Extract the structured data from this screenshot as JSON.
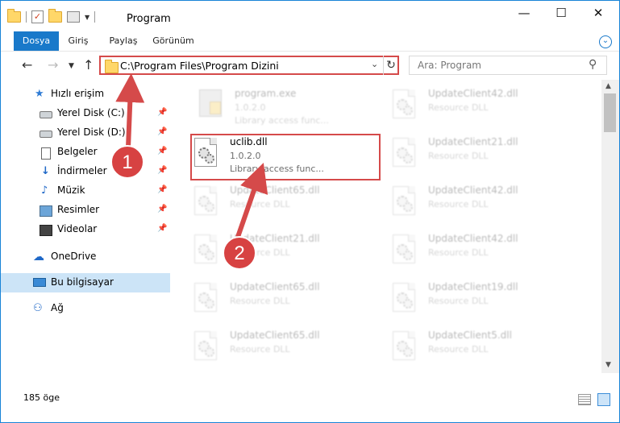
{
  "window": {
    "title": "Program"
  },
  "ribbon": {
    "tabs": [
      "Dosya",
      "Giriş",
      "Paylaş",
      "Görünüm"
    ]
  },
  "address": {
    "path": "C:\\Program Files\\Program Dizini"
  },
  "search": {
    "placeholder": "Ara: Program"
  },
  "sidebar": {
    "items": [
      {
        "label": "Hızlı erişim",
        "icon": "star-icon"
      },
      {
        "label": "Yerel Disk (C:)",
        "icon": "disk-icon",
        "pinned": true
      },
      {
        "label": "Yerel Disk (D:)",
        "icon": "disk-icon",
        "pinned": true
      },
      {
        "label": "Belgeler",
        "icon": "document-icon",
        "pinned": true
      },
      {
        "label": "İndirmeler",
        "icon": "download-icon",
        "pinned": true
      },
      {
        "label": "Müzik",
        "icon": "music-icon",
        "pinned": true
      },
      {
        "label": "Resimler",
        "icon": "pictures-icon",
        "pinned": true
      },
      {
        "label": "Videolar",
        "icon": "video-icon",
        "pinned": true
      },
      {
        "label": "OneDrive",
        "icon": "onedrive-icon"
      },
      {
        "label": "Bu bilgisayar",
        "icon": "computer-icon",
        "selected": true
      },
      {
        "label": "Ağ",
        "icon": "network-icon"
      }
    ]
  },
  "files": [
    {
      "name": "program.exe",
      "line1": "1.0.2.0",
      "line2": "Library access func...",
      "type": "exe",
      "faded": true
    },
    {
      "name": "UpdateClient42.dll",
      "line1": "Resource DLL",
      "faded": true
    },
    {
      "name": "uclib.dll",
      "line1": "1.0.2.0",
      "line2": "Library access func...",
      "faded": false
    },
    {
      "name": "UpdateClient21.dll",
      "line1": "Resource DLL",
      "faded": true
    },
    {
      "name": "UpdateClient65.dll",
      "line1": "Resource DLL",
      "faded": true
    },
    {
      "name": "UpdateClient42.dll",
      "line1": "Resource DLL",
      "faded": true
    },
    {
      "name": "UpdateClient21.dll",
      "line1": "Resource DLL",
      "faded": true
    },
    {
      "name": "UpdateClient42.dll",
      "line1": "Resource DLL",
      "faded": true
    },
    {
      "name": "UpdateClient65.dll",
      "line1": "Resource DLL",
      "faded": true
    },
    {
      "name": "UpdateClient19.dll",
      "line1": "Resource DLL",
      "faded": true
    },
    {
      "name": "UpdateClient65.dll",
      "line1": "Resource DLL",
      "faded": true
    },
    {
      "name": "UpdateClient5.dll",
      "line1": "Resource DLL",
      "faded": true
    }
  ],
  "annotations": {
    "step1": "1",
    "step2": "2"
  },
  "status": {
    "count": "185 öge"
  },
  "colors": {
    "accent": "#1979ca",
    "annotation": "#d54a4a",
    "selection": "#cce4f7"
  }
}
